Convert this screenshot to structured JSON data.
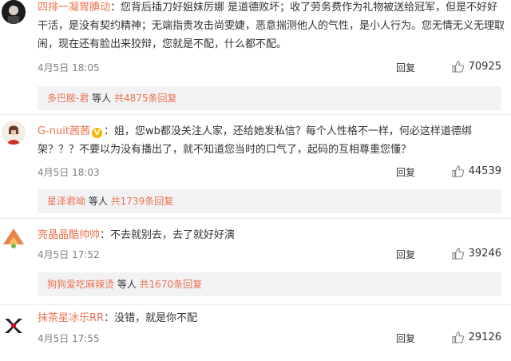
{
  "comments": [
    {
      "username": "四排一凝胃腆动",
      "verified": false,
      "text": "：您背后插刀好姐妹厉娜 是道德败坏；收了劳务费作为礼物被送给冠军，但是不好好干活，是没有契约精神；无端指责攻击尚雯婕，恶意揣测他人的气性，是小人行为。您无情无义无理取闹，现在还有脸出来狡辩，您就是不配，什么都不配。",
      "time": "4月5日 18:05",
      "reply_label": "回复",
      "likes": "70925",
      "sub_user": "多巴胺-君",
      "sub_mid": " 等人 ",
      "sub_more": "共4875条回复"
    },
    {
      "username": "G-nuit茜茜",
      "verified": true,
      "verified_icon": "V",
      "text": "：姐，您wb都没关注人家，还给她发私信？每个人性格不一样，何必这样道德绑架？？？不要以为没有播出了，就不知道您当时的口气了，起码的互相尊重您懂？",
      "time": "4月5日 18:03",
      "reply_label": "回复",
      "likes": "44539",
      "sub_user": "星泽君呦",
      "sub_mid": " 等人 ",
      "sub_more": "共1739条回复"
    },
    {
      "username": "亮晶晶酷帅帅",
      "verified": false,
      "text": "：不去就别去，去了就好好演",
      "time": "4月5日 17:52",
      "reply_label": "回复",
      "likes": "39246",
      "sub_user": "狗狗爱吃麻辣烫",
      "sub_mid": " 等人 ",
      "sub_more": "共1670条回复"
    },
    {
      "username": "抹茶星冰乐RR",
      "verified": false,
      "text": "：没错，就是你不配",
      "time": "4月5日 17:55",
      "reply_label": "回复",
      "likes": "29126"
    }
  ],
  "colors": {
    "accent": "#eb7350",
    "sub_bg": "#f2f2f5",
    "meta": "#808080"
  }
}
